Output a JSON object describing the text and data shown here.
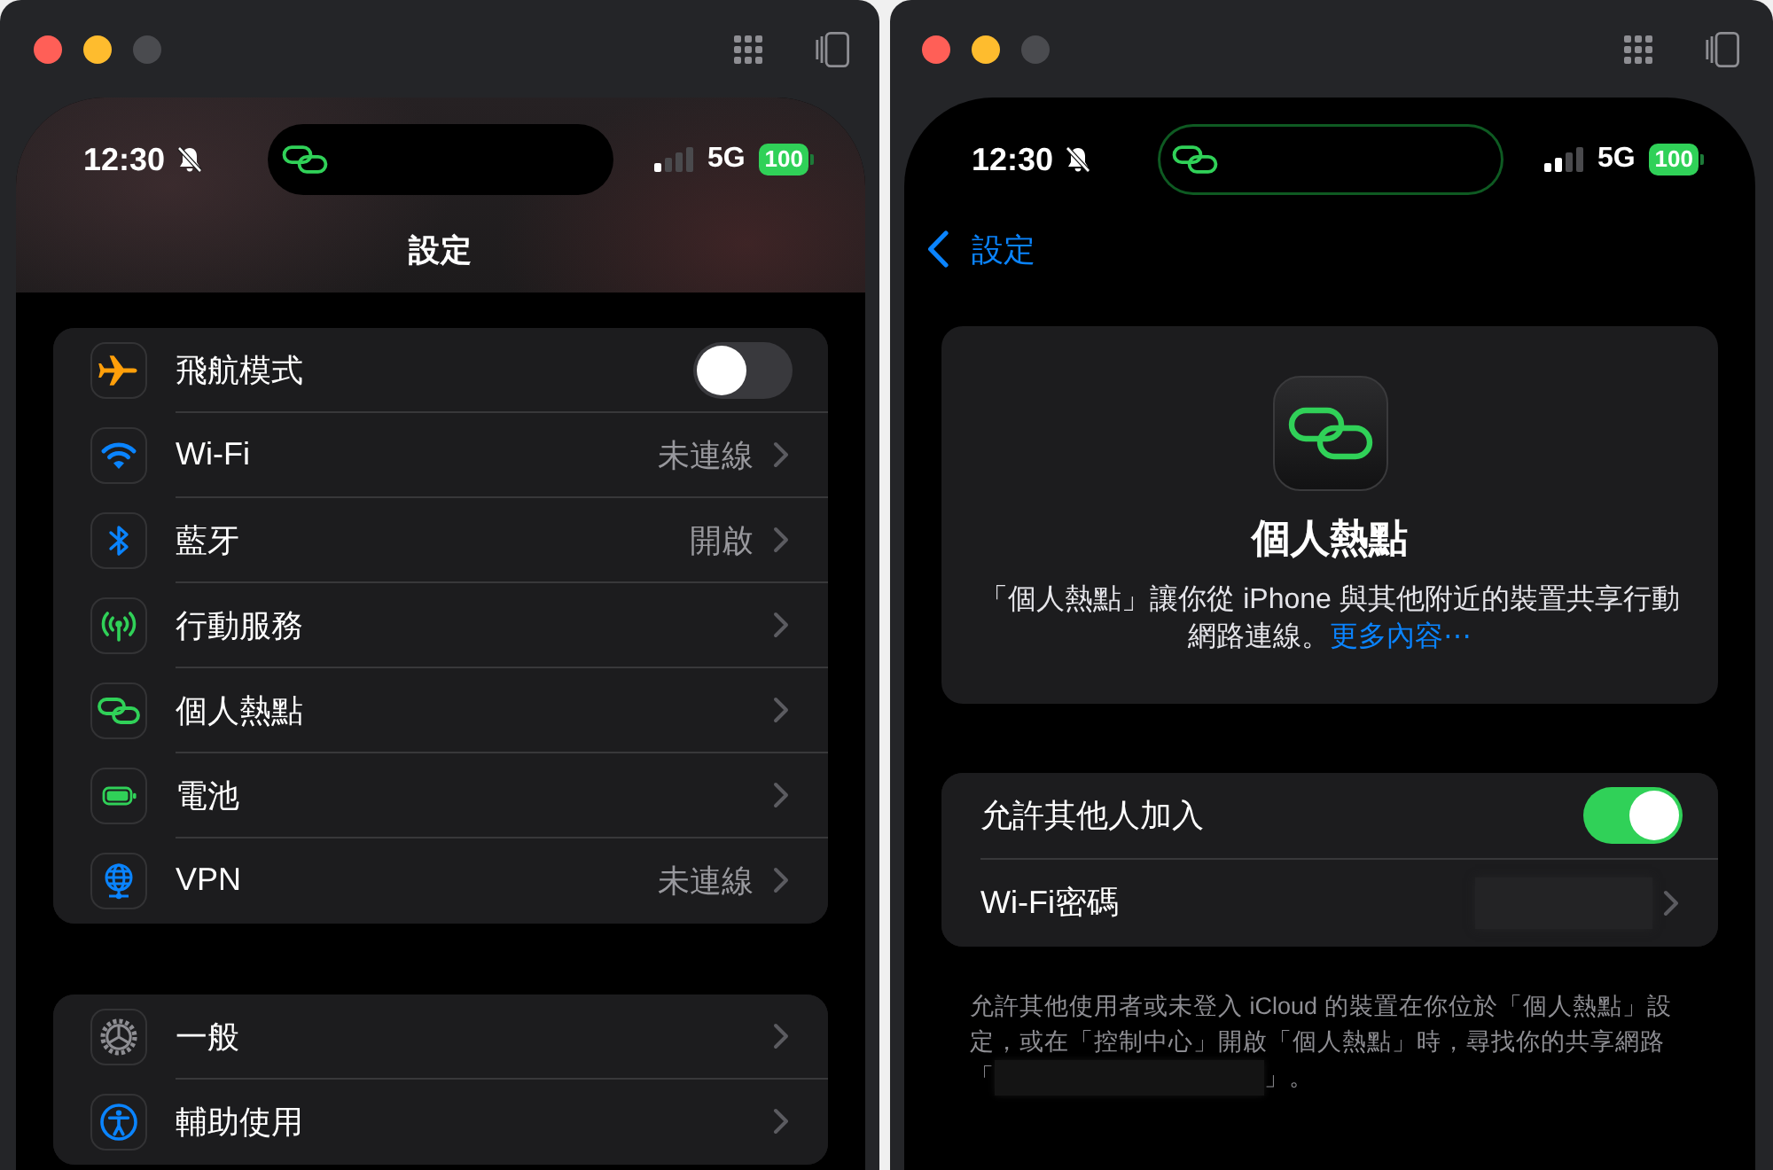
{
  "windows": [
    {
      "kind": "settings_list",
      "zoom_button": {
        "disabled": true
      },
      "status_bar": {
        "time": "12:30",
        "network": "5G",
        "battery": "100",
        "island": {
          "active": false
        }
      },
      "nav": {
        "title": "設定"
      },
      "groups": [
        {
          "rows": [
            {
              "kind": "toggle",
              "label": "飛航模式",
              "on": false
            },
            {
              "kind": "disclosure",
              "label": "Wi-Fi",
              "detail": "未連線"
            },
            {
              "kind": "disclosure",
              "label": "藍牙",
              "detail": "開啟"
            },
            {
              "kind": "disclosure",
              "label": "行動服務"
            },
            {
              "kind": "disclosure",
              "label": "個人熱點"
            },
            {
              "kind": "disclosure",
              "label": "電池"
            },
            {
              "kind": "disclosure",
              "label": "VPN",
              "detail": "未連線"
            }
          ]
        },
        {
          "rows": [
            {
              "kind": "disclosure",
              "label": "一般"
            },
            {
              "kind": "disclosure",
              "label": "輔助使用"
            }
          ]
        }
      ]
    },
    {
      "kind": "hotspot_detail",
      "zoom_button": {
        "disabled": true
      },
      "status_bar": {
        "time": "12:30",
        "network": "5G",
        "battery": "100",
        "island": {
          "active": true
        }
      },
      "nav": {
        "back": "設定"
      },
      "header_card": {
        "title": "個人熱點",
        "description": "「個人熱點」讓你從 iPhone 與其他附近的裝置共享行動網路連線。",
        "link": "更多內容⋯"
      },
      "groups": [
        {
          "rows": [
            {
              "kind": "toggle",
              "label": "允許其他人加入",
              "on": true
            },
            {
              "kind": "disclosure",
              "label": "Wi-Fi密碼",
              "redacted": true
            }
          ]
        }
      ],
      "footer": {
        "text": "允許其他使用者或未登入 iCloud 的裝置在你位於「個人熱點」設定，或在「控制中心」開啟「個人熱點」時，尋找你的共享網路「",
        "redacted": true,
        "text_after": "」。"
      }
    }
  ]
}
